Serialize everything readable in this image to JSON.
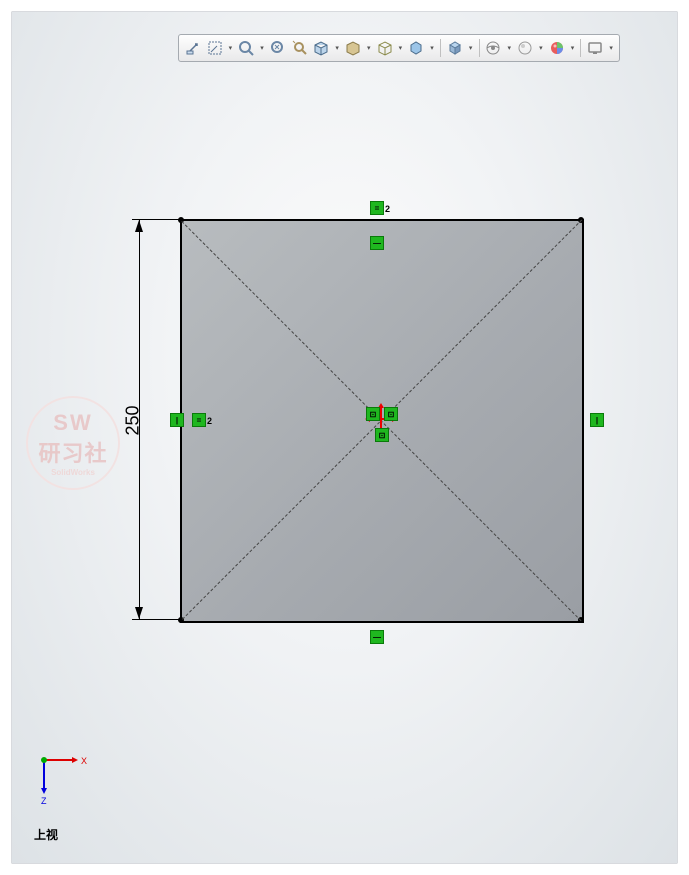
{
  "toolbar": {
    "icons": [
      "zoom-extents",
      "zoom-window",
      "zoom-previous",
      "zoom-in-out",
      "pan",
      "rotate",
      "section-view",
      "display-style",
      "hlr",
      "tangent",
      "perspective",
      "cartoon",
      "show-hide",
      "sphere",
      "edit-appearance",
      "apply-scene",
      "view-settings"
    ]
  },
  "sketch": {
    "dimension": "250",
    "constraint_subscript": "2"
  },
  "watermark": {
    "line1": "SW",
    "line2": "研习社",
    "line3": "SolidWorks"
  },
  "triad": {
    "x": "X",
    "z": "Z"
  },
  "view_label": "上视"
}
